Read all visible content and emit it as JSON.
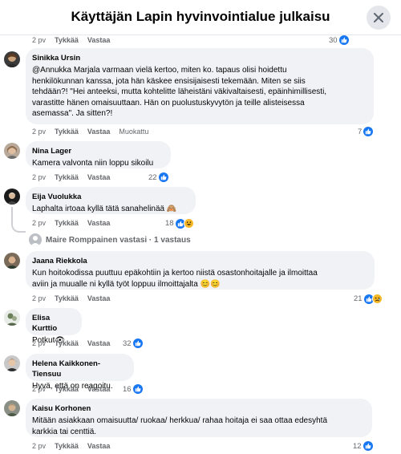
{
  "header": {
    "title": "Käyttäjän Lapin hyvinvointialue julkaisu"
  },
  "top_row": {
    "age": "2 pv",
    "like": "Tykkää",
    "reply": "Vastaa",
    "count": "30"
  },
  "comments": [
    {
      "author": "Sinikka Ursin",
      "lines": [
        "@Annukka Marjala varmaan vielä kertoo, miten ko. tapaus olisi hoidettu",
        "henkilökunnan kanssa, jota hän käskee ensisijaisesti tekemään. Miten se siis",
        "tehdään?! \"Hei anteeksi, mutta kohtelitte läheistäni väkivaltaisesti, epäinhimillisesti,",
        "varastitte hänen omaisuuttaan. Hän on puolustuskyvytön ja teille alisteisessa",
        "asemassa\". Ja sitten?!"
      ],
      "age": "2 pv",
      "like": "Tykkää",
      "reply": "Vastaa",
      "edited": "Muokattu",
      "count": "7"
    },
    {
      "author": "Nina Lager",
      "lines": [
        "Kamera valvonta niin loppu sikoilu"
      ],
      "age": "2 pv",
      "like": "Tykkää",
      "reply": "Vastaa",
      "count": "22"
    },
    {
      "author": "Eija Vuolukka",
      "lines": [
        "Laphalta irtoaa kyllä tätä sanahelinää 🙈"
      ],
      "age": "2 pv",
      "like": "Tykkää",
      "reply": "Vastaa",
      "count": "18"
    },
    {
      "author": "Jaana Riekkola",
      "lines": [
        "Kun hoitokodissa puuttuu epäkohtiin ja kertoo niistä osastonhoitajalle ja ilmoittaa",
        "aviin ja muualle ni kyllä työt loppuu ilmoittajalta 😊😊"
      ],
      "age": "2 pv",
      "like": "Tykkää",
      "reply": "Vastaa",
      "count": "21"
    },
    {
      "author": "Elisa Kurttio",
      "lines": [
        "Potkut👁"
      ],
      "age": "2 pv",
      "like": "Tykkää",
      "reply": "Vastaa",
      "count": "32"
    },
    {
      "author": "Helena Kaikkonen-Tiensuu",
      "lines": [
        "Hyvä, että on reagoitu."
      ],
      "age": "2 pv",
      "like": "Tykkää",
      "reply": "Vastaa",
      "count": "16"
    },
    {
      "author": "Kaisu Korhonen",
      "lines": [
        "Mitään asiakkaan omaisuutta/ ruokaa/ herkkua/ rahaa hoitaja ei saa ottaa edesyhtä",
        "karkkia tai centtiä."
      ],
      "age": "2 pv",
      "like": "Tykkää",
      "reply": "Vastaa",
      "count": "12"
    }
  ],
  "reply_link": {
    "text": "Maire Romppainen vastasi · 1 vastaus"
  },
  "colors": {
    "like_blue": "#1877f2",
    "bubble_bg": "#f0f2f5",
    "meta_gray": "#65676b"
  }
}
